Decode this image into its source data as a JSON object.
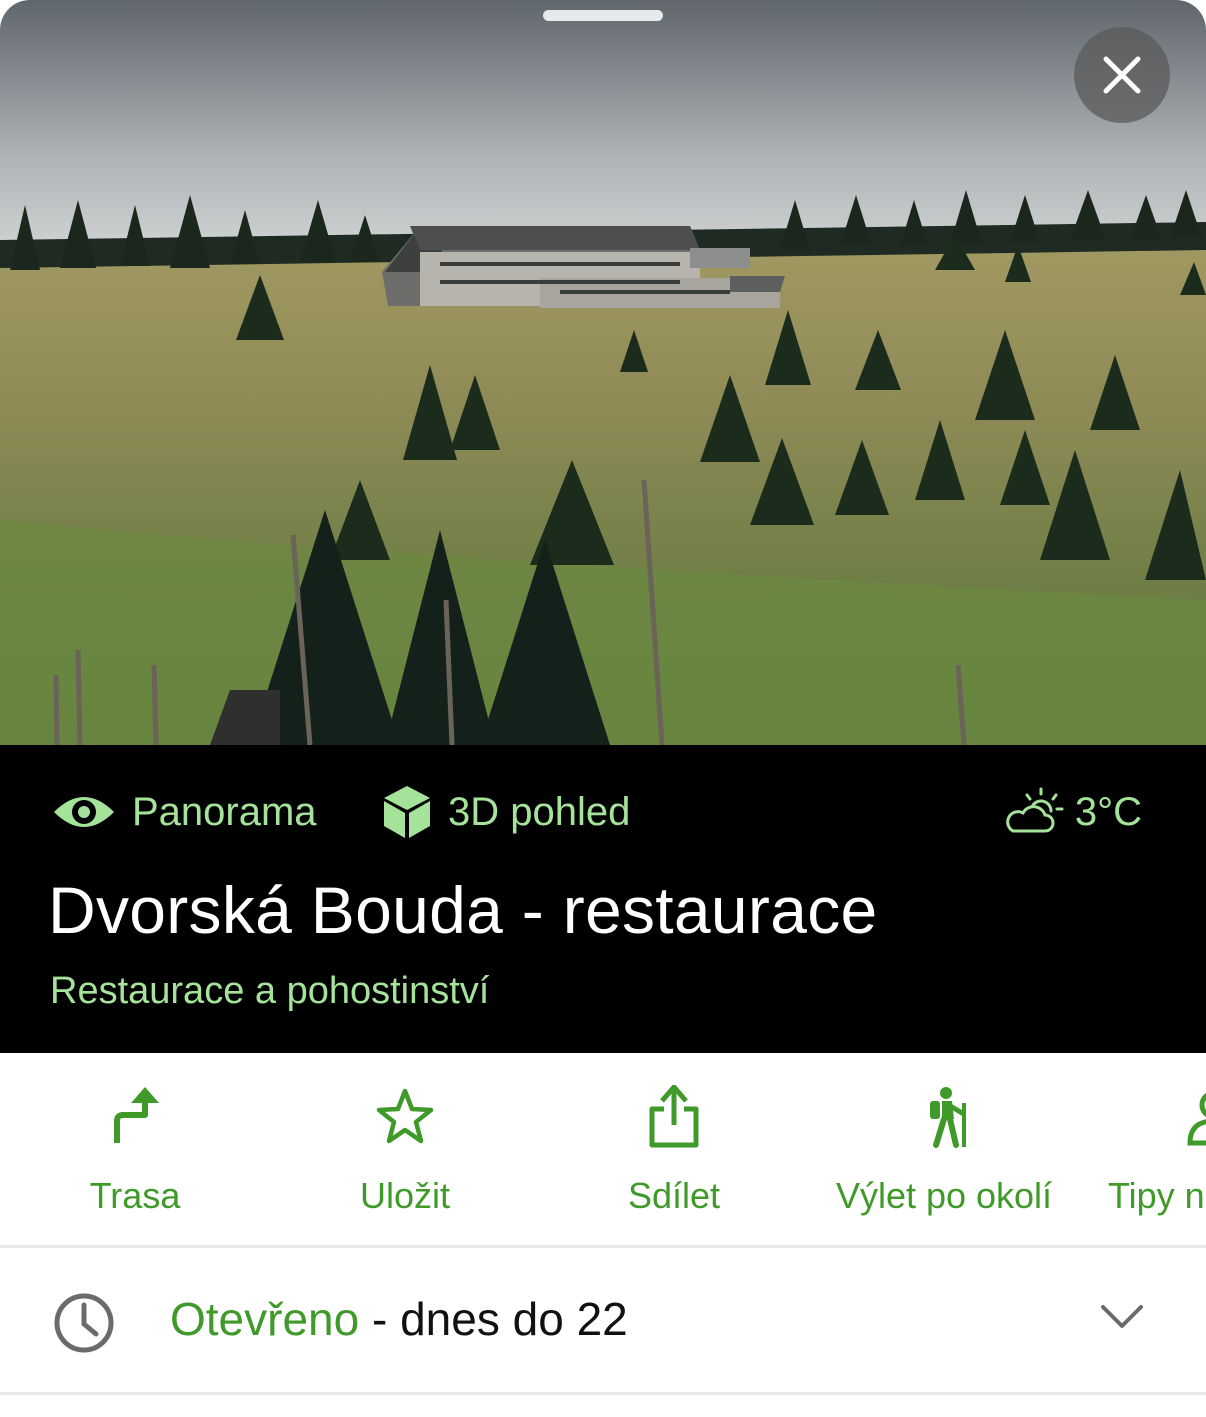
{
  "photo": {
    "alt_icon": "landscape-photo"
  },
  "close": {
    "icon": "close-icon"
  },
  "chips": {
    "panorama": {
      "label": "Panorama",
      "icon": "eye-icon"
    },
    "view3d": {
      "label": "3D pohled",
      "icon": "cube-icon"
    },
    "weather": {
      "label": "3°C",
      "icon": "cloud-sun-icon"
    }
  },
  "place": {
    "title": "Dvorská Bouda - restaurace",
    "category": "Restaurace a pohostinství"
  },
  "actions": [
    {
      "label": "Trasa",
      "icon": "route-arrow-icon"
    },
    {
      "label": "Uložit",
      "icon": "star-icon"
    },
    {
      "label": "Sdílet",
      "icon": "share-icon"
    },
    {
      "label": "Výlet po okolí",
      "icon": "hiker-icon"
    },
    {
      "label": "Tipy n",
      "icon": "tips-icon"
    }
  ],
  "hours": {
    "status": "Otevřeno",
    "detail": " - dnes do 22"
  },
  "colors": {
    "accent": "#3f9a2a",
    "accent_light": "#a6e39a",
    "header_bg": "#000000"
  }
}
